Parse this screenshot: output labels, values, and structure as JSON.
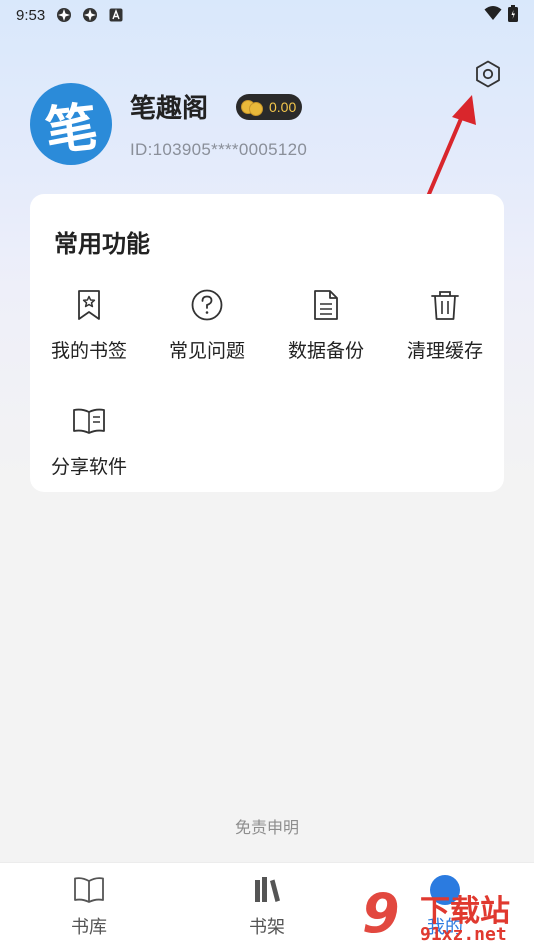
{
  "status_bar": {
    "time": "9:53"
  },
  "profile": {
    "avatar_char": "笔",
    "username": "笔趣阁",
    "coins": "0.00",
    "user_id": "ID:103905****0005120"
  },
  "common_functions": {
    "title": "常用功能",
    "items": [
      {
        "label": "我的书签",
        "icon": "bookmark-icon"
      },
      {
        "label": "常见问题",
        "icon": "question-icon"
      },
      {
        "label": "数据备份",
        "icon": "document-icon"
      },
      {
        "label": "清理缓存",
        "icon": "trash-icon"
      },
      {
        "label": "分享软件",
        "icon": "open-book-icon"
      }
    ]
  },
  "disclaimer": "免责申明",
  "bottom_nav": {
    "items": [
      {
        "label": "书库",
        "icon": "book-icon",
        "active": false
      },
      {
        "label": "书架",
        "icon": "bookshelf-icon",
        "active": false
      },
      {
        "label": "我的",
        "icon": "profile-icon",
        "active": true
      }
    ]
  },
  "watermark": {
    "number": "9",
    "title": "下载站",
    "subtitle": "91xz.net"
  },
  "colors": {
    "accent": "#2b7be0",
    "annotation_arrow": "#d9262c",
    "watermark": "#e0392f"
  }
}
